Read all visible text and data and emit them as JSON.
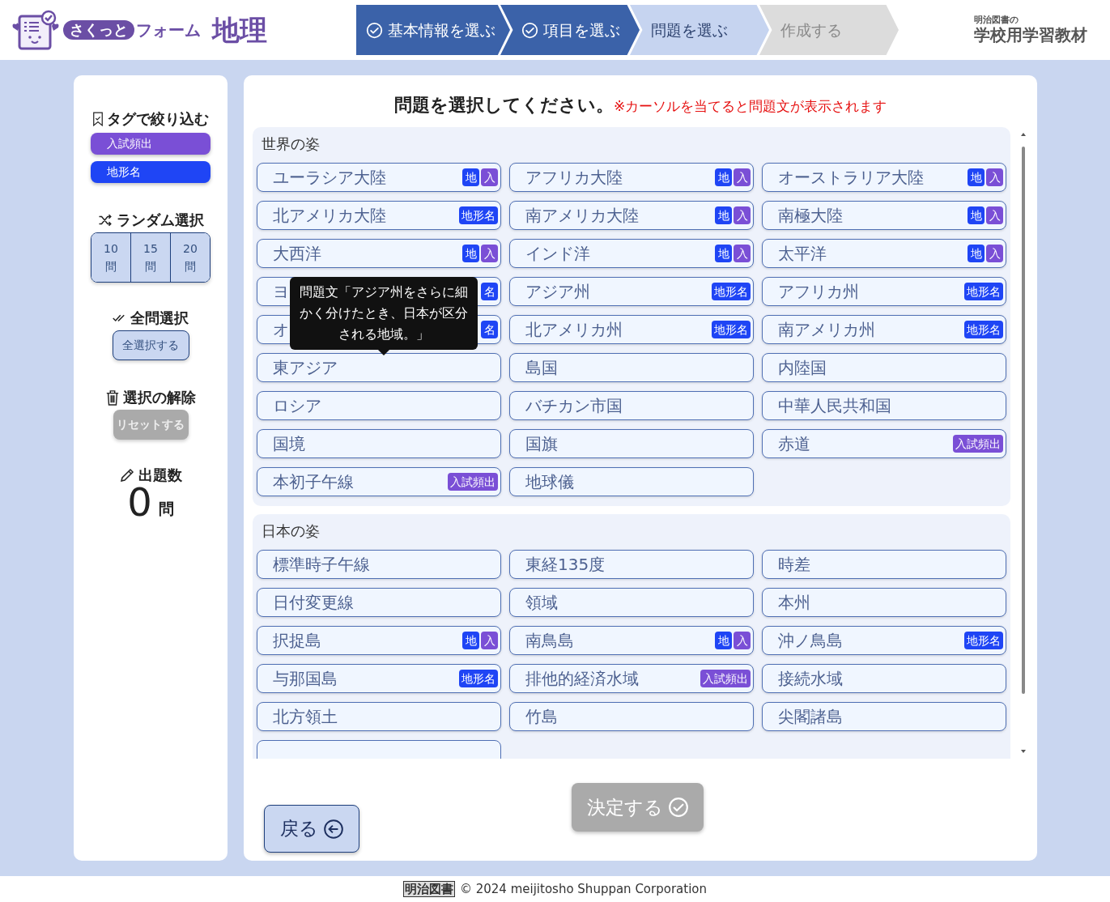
{
  "header": {
    "logo_badge": "さくっと",
    "logo_text": "フォーム",
    "subject": "地理",
    "publisher_small": "明治図書の",
    "publisher_large": "学校用学習教材"
  },
  "steps": [
    {
      "label": "基本情報を選ぶ",
      "completed": true,
      "selected": false
    },
    {
      "label": "項目を選ぶ",
      "completed": true,
      "selected": false
    },
    {
      "label": "問題を選ぶ",
      "completed": false,
      "selected": true
    },
    {
      "label": "作成する",
      "completed": false,
      "selected": false
    }
  ],
  "sidebar": {
    "filter_title": "タグで絞り込む",
    "filters": [
      {
        "label": "入試頻出",
        "kind": "exam"
      },
      {
        "label": "地形名",
        "kind": "landform"
      }
    ],
    "random_title": "ランダム選択",
    "random_options": [
      {
        "count": "10",
        "unit": "問"
      },
      {
        "count": "15",
        "unit": "問"
      },
      {
        "count": "20",
        "unit": "問"
      }
    ],
    "select_all_title": "全問選択",
    "select_all_button": "全選択する",
    "reset_title": "選択の解除",
    "reset_button": "リセットする",
    "reset_disabled": true,
    "count_title": "出題数",
    "count": "0",
    "count_unit": "問"
  },
  "main": {
    "title": "問題を選択してください。",
    "note": "※カーソルを当てると問題文が表示されます",
    "sections": [
      {
        "title": "世界の姿",
        "cut_off_row": false,
        "items": [
          {
            "label": "ユーラシア大陸",
            "tags": [
              {
                "text": "地",
                "kind": "landform"
              },
              {
                "text": "入",
                "kind": "exam"
              }
            ]
          },
          {
            "label": "アフリカ大陸",
            "tags": [
              {
                "text": "地",
                "kind": "landform"
              },
              {
                "text": "入",
                "kind": "exam"
              }
            ]
          },
          {
            "label": "オーストラリア大陸",
            "tags": [
              {
                "text": "地",
                "kind": "landform"
              },
              {
                "text": "入",
                "kind": "exam"
              }
            ]
          },
          {
            "label": "北アメリカ大陸",
            "tags": [
              {
                "text": "地形名",
                "kind": "landform"
              }
            ]
          },
          {
            "label": "南アメリカ大陸",
            "tags": [
              {
                "text": "地",
                "kind": "landform"
              },
              {
                "text": "入",
                "kind": "exam"
              }
            ]
          },
          {
            "label": "南極大陸",
            "tags": [
              {
                "text": "地",
                "kind": "landform"
              },
              {
                "text": "入",
                "kind": "exam"
              }
            ]
          },
          {
            "label": "大西洋",
            "tags": [
              {
                "text": "地",
                "kind": "landform"
              },
              {
                "text": "入",
                "kind": "exam"
              }
            ]
          },
          {
            "label": "インド洋",
            "tags": [
              {
                "text": "地",
                "kind": "landform"
              },
              {
                "text": "入",
                "kind": "exam"
              }
            ]
          },
          {
            "label": "太平洋",
            "tags": [
              {
                "text": "地",
                "kind": "landform"
              },
              {
                "text": "入",
                "kind": "exam"
              }
            ]
          },
          {
            "label": "ヨ",
            "tags": [
              {
                "text": "名",
                "kind": "landform"
              }
            ]
          },
          {
            "label": "アジア州",
            "tags": [
              {
                "text": "地形名",
                "kind": "landform"
              }
            ]
          },
          {
            "label": "アフリカ州",
            "tags": [
              {
                "text": "地形名",
                "kind": "landform"
              }
            ]
          },
          {
            "label": "オ",
            "tags": [
              {
                "text": "名",
                "kind": "landform"
              }
            ]
          },
          {
            "label": "北アメリカ州",
            "tags": [
              {
                "text": "地形名",
                "kind": "landform"
              }
            ]
          },
          {
            "label": "南アメリカ州",
            "tags": [
              {
                "text": "地形名",
                "kind": "landform"
              }
            ]
          },
          {
            "label": "東アジア"
          },
          {
            "label": "島国"
          },
          {
            "label": "内陸国"
          },
          {
            "label": "ロシア"
          },
          {
            "label": "バチカン市国"
          },
          {
            "label": "中華人民共和国"
          },
          {
            "label": "国境"
          },
          {
            "label": "国旗"
          },
          {
            "label": "赤道",
            "tags": [
              {
                "text": "入試頻出",
                "kind": "exam"
              }
            ]
          },
          {
            "label": "本初子午線",
            "tags": [
              {
                "text": "入試頻出",
                "kind": "exam"
              }
            ]
          },
          {
            "label": "地球儀"
          }
        ],
        "tooltip": "問題文「アジア州をさらに細かく分けたとき、日本が区分される地域。」"
      },
      {
        "title": "日本の姿",
        "cut_off_row": true,
        "items": [
          {
            "label": "標準時子午線"
          },
          {
            "label": "東経135度"
          },
          {
            "label": "時差"
          },
          {
            "label": "日付変更線"
          },
          {
            "label": "領域"
          },
          {
            "label": "本州"
          },
          {
            "label": "択捉島",
            "tags": [
              {
                "text": "地",
                "kind": "landform"
              },
              {
                "text": "入",
                "kind": "exam"
              }
            ]
          },
          {
            "label": "南鳥島",
            "tags": [
              {
                "text": "地",
                "kind": "landform"
              },
              {
                "text": "入",
                "kind": "exam"
              }
            ]
          },
          {
            "label": "沖ノ鳥島",
            "tags": [
              {
                "text": "地形名",
                "kind": "landform"
              }
            ]
          },
          {
            "label": "与那国島",
            "tags": [
              {
                "text": "地形名",
                "kind": "landform"
              }
            ]
          },
          {
            "label": "排他的経済水域",
            "tags": [
              {
                "text": "入試頻出",
                "kind": "exam"
              }
            ]
          },
          {
            "label": "接続水域"
          },
          {
            "label": "北方領土"
          },
          {
            "label": "竹島"
          },
          {
            "label": "尖閣諸島"
          }
        ]
      }
    ],
    "back_button": "戻る",
    "confirm_button": "決定する",
    "confirm_disabled": true
  },
  "footer": {
    "brand": "明治図書",
    "copyright": "© 2024 meijitosho Shuppan Corporation"
  }
}
